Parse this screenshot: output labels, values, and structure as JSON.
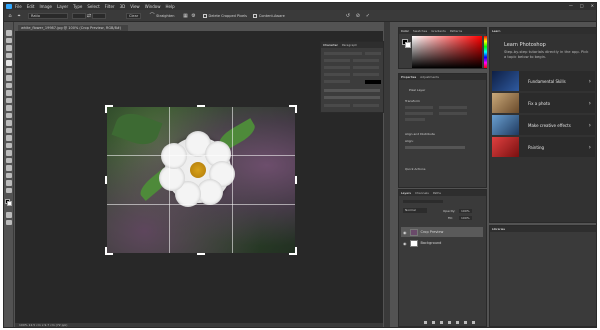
{
  "menubar": {
    "items": [
      "File",
      "Edit",
      "Image",
      "Layer",
      "Type",
      "Select",
      "Filter",
      "3D",
      "View",
      "Window",
      "Help"
    ]
  },
  "options": {
    "ratio_value": "Ratio",
    "clear_label": "Clear",
    "straighten_label": "Straighten",
    "delete_cropped_label": "Delete Cropped Pixels",
    "content_aware_label": "Content-Aware"
  },
  "document": {
    "tab_title": "white_flower_19987.jpg @ 100% (Crop Preview, RGB/8#)",
    "status": "100%    12.5 cm x 9.7 cm (72 ppi)"
  },
  "character_panel": {
    "tabs": [
      "Character",
      "Paragraph"
    ]
  },
  "color_panel": {
    "tabs": [
      "Color",
      "Swatches",
      "Gradients",
      "Patterns"
    ]
  },
  "properties_panel": {
    "tabs": [
      "Properties",
      "Adjustments"
    ],
    "section_pixel": "Pixel Layer",
    "section_transform": "Transform",
    "section_align": "Align and Distribute",
    "section_align_sub": "Align:",
    "section_quick": "Quick Actions"
  },
  "layers_panel": {
    "tabs": [
      "Layers",
      "Channels",
      "Paths"
    ],
    "blend_mode": "Normal",
    "opacity_label": "Opacity:",
    "opacity_value": "100%",
    "fill_label": "Fill:",
    "fill_value": "100%",
    "layers": [
      {
        "name": "Crop Preview",
        "selected": true
      },
      {
        "name": "Background",
        "selected": false
      }
    ]
  },
  "learn_panel": {
    "tab": "Learn",
    "title": "Learn Photoshop",
    "description": "Step-by-step tutorials directly in the app. Pick a topic below to begin.",
    "lessons": [
      {
        "label": "Fundamental Skills",
        "thumb_color": "#1e3a6e"
      },
      {
        "label": "Fix a photo",
        "thumb_color": "#7a5a3a"
      },
      {
        "label": "Make creative effects",
        "thumb_color": "#3a6aa0"
      },
      {
        "label": "Painting",
        "thumb_color": "#b03030"
      }
    ]
  },
  "libraries_panel": {
    "tab": "Libraries"
  },
  "colors": {
    "accent": "#31a8ff",
    "app_bg": "#535353",
    "canvas_bg": "#282828",
    "panel_bg": "#3a3a3a"
  }
}
